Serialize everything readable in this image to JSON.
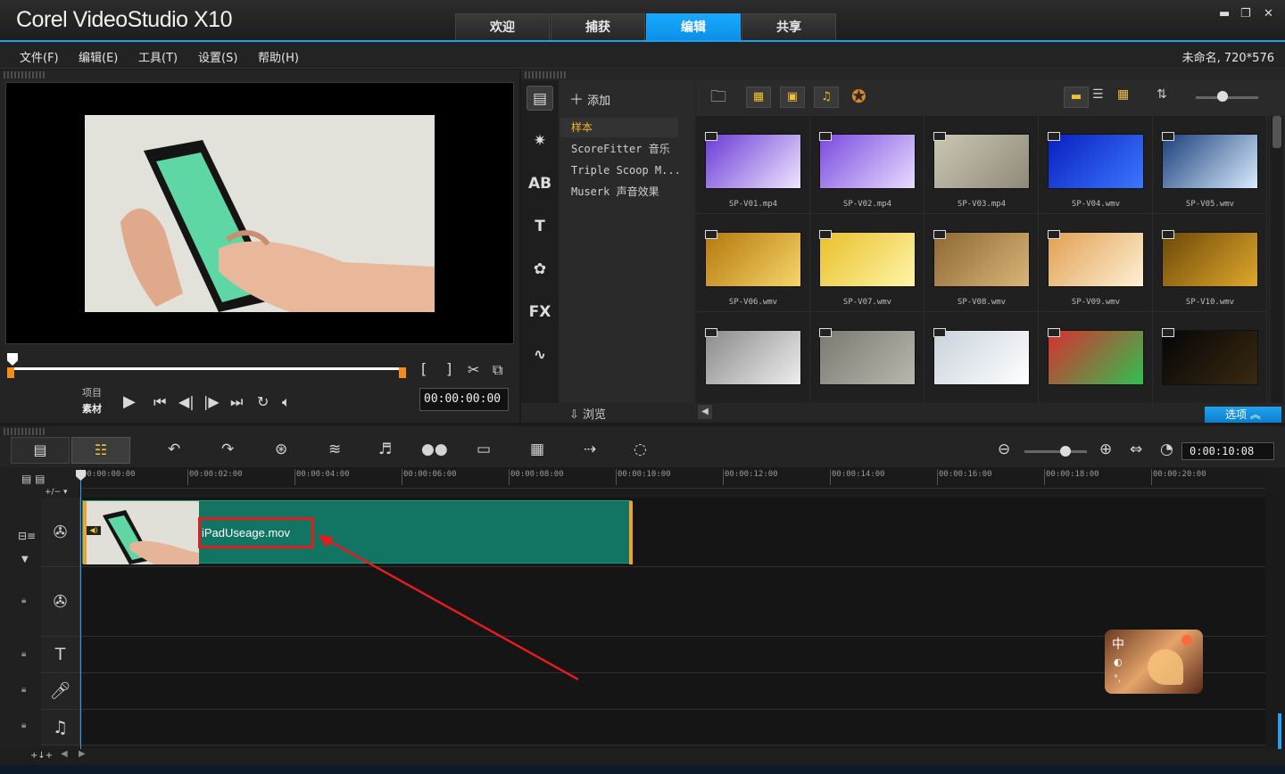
{
  "app": {
    "title": "Corel VideoStudio X10"
  },
  "main_tabs": [
    {
      "label": "欢迎",
      "active": false
    },
    {
      "label": "捕获",
      "active": false
    },
    {
      "label": "编辑",
      "active": true
    },
    {
      "label": "共享",
      "active": false
    }
  ],
  "window_controls": {
    "minimize": "▬",
    "restore": "❐",
    "close": "✕"
  },
  "menu": [
    "文件(F)",
    "编辑(E)",
    "工具(T)",
    "设置(S)",
    "帮助(H)"
  ],
  "project_info": "未命名, 720*576",
  "player": {
    "mode_labels": [
      "项目",
      "素材"
    ],
    "timecode": "00:00:00:00",
    "in_bracket": "[",
    "out_bracket": "]"
  },
  "library": {
    "add_label": "添加",
    "browse_label": "浏览",
    "options_label": "选项",
    "folders": [
      {
        "label": "样本",
        "active": true
      },
      {
        "label": "ScoreFitter 音乐",
        "active": false
      },
      {
        "label": "Triple Scoop M...",
        "active": false
      },
      {
        "label": "Muserk 声音效果",
        "active": false
      }
    ],
    "category_icons": [
      "media-icon",
      "instant-project-icon",
      "transition-icon",
      "title-icon",
      "graphic-icon",
      "filter-icon",
      "path-icon"
    ],
    "category_glyphs": [
      "▤",
      "✷",
      "AB",
      "T",
      "✿",
      "FX",
      "∿"
    ],
    "thumbnails": [
      {
        "label": "SP-V01.mp4",
        "color1": "#6a3bd6",
        "color2": "#f0e6ff"
      },
      {
        "label": "SP-V02.mp4",
        "color1": "#7a4ae0",
        "color2": "#e8dcff"
      },
      {
        "label": "SP-V03.mp4",
        "color1": "#cbc6b4",
        "color2": "#8e8a7b"
      },
      {
        "label": "SP-V04.wmv",
        "color1": "#0a1fbf",
        "color2": "#3a78ff"
      },
      {
        "label": "SP-V05.wmv",
        "color1": "#1a3f7a",
        "color2": "#d9ecff"
      },
      {
        "label": "SP-V06.wmv",
        "color1": "#b5790c",
        "color2": "#f5d56a"
      },
      {
        "label": "SP-V07.wmv",
        "color1": "#e8c02a",
        "color2": "#fff4a8"
      },
      {
        "label": "SP-V08.wmv",
        "color1": "#8d6a34",
        "color2": "#d9b478"
      },
      {
        "label": "SP-V09.wmv",
        "color1": "#e0a050",
        "color2": "#fff0d6"
      },
      {
        "label": "SP-V10.wmv",
        "color1": "#6b4a08",
        "color2": "#e0a72c"
      },
      {
        "label": "",
        "color1": "#8a8a8a",
        "color2": "#eeeeee"
      },
      {
        "label": "",
        "color1": "#7a7a72",
        "color2": "#b8b8ac"
      },
      {
        "label": "",
        "color1": "#c8d2dc",
        "color2": "#ffffff"
      },
      {
        "label": "",
        "color1": "#d83030",
        "color2": "#30c050"
      },
      {
        "label": "",
        "color1": "#050508",
        "color2": "#3a2a10"
      }
    ]
  },
  "timeline": {
    "timecode": "0:00:10:08",
    "ruler_labels": [
      "00:00:00:00",
      "00:00:02:00",
      "00:00:04:00",
      "00:00:06:00",
      "00:00:08:00",
      "00:00:10:00",
      "00:00:12:00",
      "00:00:14:00",
      "00:00:16:00",
      "00:00:18:00",
      "00:00:20:00"
    ],
    "clip_name": "iPadUseage.mov"
  },
  "colors": {
    "accent": "#1aa0f0",
    "clip": "#127563",
    "highlight": "#e21d1d",
    "folder_active": "#f4b428"
  }
}
